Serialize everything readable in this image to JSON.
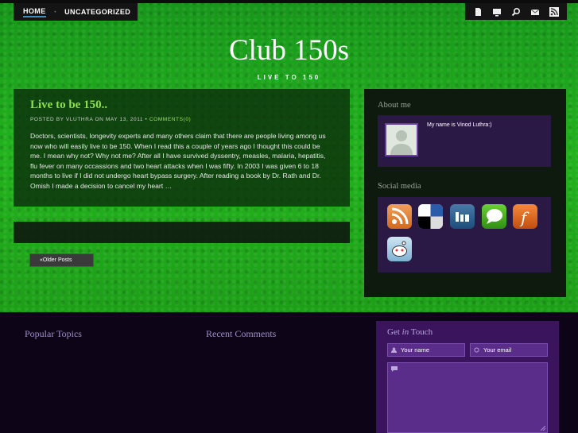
{
  "nav": {
    "home": "HOME",
    "separator": "•",
    "uncategorized": "UNCATEGORIZED"
  },
  "header_icons": [
    "page-icon",
    "monitor-icon",
    "search-icon",
    "mail-icon",
    "rss-icon"
  ],
  "site": {
    "title": "Club 150s",
    "description": "LIVE TO 150"
  },
  "post": {
    "title": "Live to be 150..",
    "meta_prefix": "POSTED BY VLUTHRA ON MAY 13, 2011 •",
    "comments": "COMMENTS(0)",
    "excerpt": "Doctors, scientists, longevity experts and many others claim that there are people living among us now who will easily live to be 150.  When I read this a couple of years ago I thought this could be me. I mean why not?  Why not me? After all I have survived dyssentry, measles, malaria, hepatitis, flu fever on many occassions and two heart attacks when I was fifty. In 2003 I was given 6 to 18 months to live if I did not undergo heart bypass surgery. After reading a book by Dr. Rath and Dr. Omish I made a decision to cancel my heart …"
  },
  "older_posts": "«Older Posts",
  "sidebar": {
    "about_title": "About me",
    "about_text": "My name is Vinod Luthra:)",
    "social_title": "Social media",
    "social_icons": [
      "rss-icon",
      "delicious-icon",
      "digg-icon",
      "technorati-icon",
      "friendfeed-icon",
      "reddit-icon"
    ]
  },
  "footer": {
    "popular_title": "Popular Topics",
    "recent_title": "Recent Comments",
    "touch_pre": "Get",
    "touch_in": "in",
    "touch_post": "Touch",
    "name_placeholder": "Your name",
    "email_placeholder": "Your email"
  },
  "colors": {
    "grass": "#1e9e18",
    "post_title": "#8fe04a",
    "widget_box": "#2a1845",
    "footer_bg": "#0e0417",
    "touch_box": "#3a145c"
  }
}
